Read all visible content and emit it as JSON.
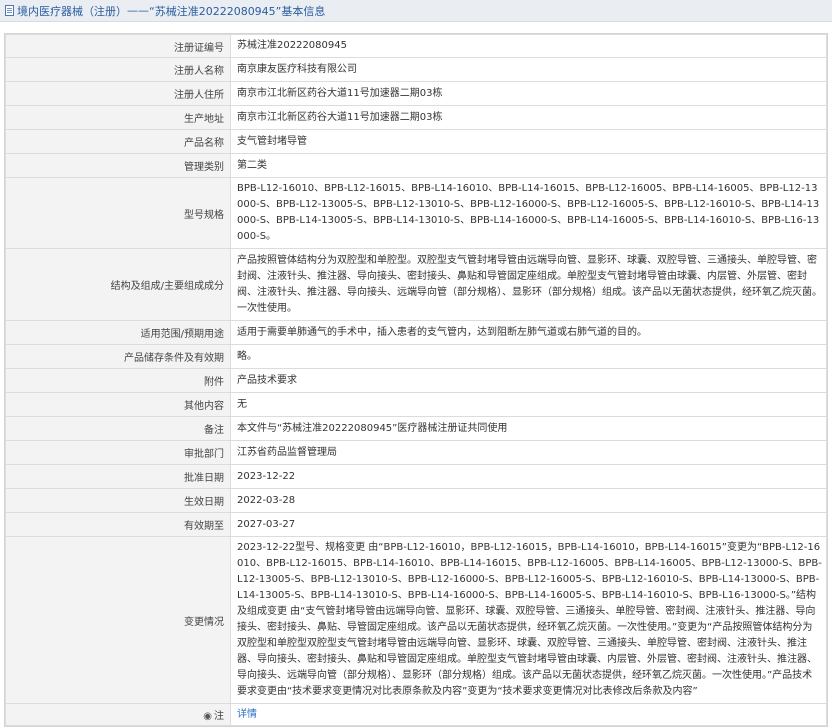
{
  "header": {
    "breadcrumb_root": "境内医疗器械（注册）",
    "breadcrumb_sep": "——",
    "breadcrumb_current": "“苏械注准20222080945”基本信息"
  },
  "rows": [
    {
      "label": "注册证编号",
      "value": "苏械注准20222080945"
    },
    {
      "label": "注册人名称",
      "value": "南京康友医疗科技有限公司"
    },
    {
      "label": "注册人住所",
      "value": "南京市江北新区药谷大道11号加速器二期03栋"
    },
    {
      "label": "生产地址",
      "value": "南京市江北新区药谷大道11号加速器二期03栋"
    },
    {
      "label": "产品名称",
      "value": "支气管封堵导管"
    },
    {
      "label": "管理类别",
      "value": "第二类"
    },
    {
      "label": "型号规格",
      "value": "BPB-L12-16010、BPB-L12-16015、BPB-L14-16010、BPB-L14-16015、BPB-L12-16005、BPB-L14-16005、BPB-L12-13000-S、BPB-L12-13005-S、BPB-L12-13010-S、BPB-L12-16000-S、BPB-L12-16005-S、BPB-L12-16010-S、BPB-L14-13000-S、BPB-L14-13005-S、BPB-L14-13010-S、BPB-L14-16000-S、BPB-L14-16005-S、BPB-L14-16010-S、BPB-L16-13000-S。"
    },
    {
      "label": "结构及组成/主要组成成分",
      "value": "产品按照管体结构分为双腔型和单腔型。双腔型支气管封堵导管由远端导向管、显影环、球囊、双腔导管、三通接头、单腔导管、密封阀、注液针头、推注器、导向接头、密封接头、鼻贴和导管固定座组成。单腔型支气管封堵导管由球囊、内层管、外层管、密封阀、注液针头、推注器、导向接头、远端导向管（部分规格）、显影环（部分规格）组成。该产品以无菌状态提供，经环氧乙烷灭菌。一次性使用。"
    },
    {
      "label": "适用范围/预期用途",
      "value": "适用于需要单肺通气的手术中，插入患者的支气管内，达到阻断左肺气道或右肺气道的目的。"
    },
    {
      "label": "产品储存条件及有效期",
      "value": "略。"
    },
    {
      "label": "附件",
      "value": "产品技术要求"
    },
    {
      "label": "其他内容",
      "value": "无"
    },
    {
      "label": "备注",
      "value": "本文件与“苏械注准20222080945”医疗器械注册证共同使用"
    },
    {
      "label": "审批部门",
      "value": "江苏省药品监督管理局"
    },
    {
      "label": "批准日期",
      "value": "2023-12-22"
    },
    {
      "label": "生效日期",
      "value": "2022-03-28"
    },
    {
      "label": "有效期至",
      "value": "2027-03-27"
    },
    {
      "label": "变更情况",
      "value": "2023-12-22型号、规格变更 由“BPB-L12-16010，BPB-L12-16015，BPB-L14-16010，BPB-L14-16015”变更为“BPB-L12-16010、BPB-L12-16015、BPB-L14-16010、BPB-L14-16015、BPB-L12-16005、BPB-L14-16005、BPB-L12-13000-S、BPB-L12-13005-S、BPB-L12-13010-S、BPB-L12-16000-S、BPB-L12-16005-S、BPB-L12-16010-S、BPB-L14-13000-S、BPB-L14-13005-S、BPB-L14-13010-S、BPB-L14-16000-S、BPB-L14-16005-S、BPB-L14-16010-S、BPB-L16-13000-S。”结构及组成变更 由“支气管封堵导管由远端导向管、显影环、球囊、双腔导管、三通接头、单腔导管、密封阀、注液针头、推注器、导向接头、密封接头、鼻贴、导管固定座组成。该产品以无菌状态提供，经环氧乙烷灭菌。一次性使用。”变更为“产品按照管体结构分为双腔型和单腔型双腔型支气管封堵导管由远端导向管、显影环、球囊、双腔导管、三通接头、单腔导管、密封阀、注液针头、推注器、导向接头、密封接头、鼻贴和导管固定座组成。单腔型支气管封堵导管由球囊、内层管、外层管、密封阀、注液针头、推注器、导向接头、远端导向管（部分规格）、显影环（部分规格）组成。该产品以无菌状态提供，经环氧乙烷灭菌。一次性使用。”产品技术要求变更由“技术要求变更情况对比表原条款及内容”变更为“技术要求变更情况对比表修改后条款及内容”"
    }
  ],
  "footer_row": {
    "label": "注",
    "pin_icon": "pin-icon",
    "link": "详情"
  }
}
